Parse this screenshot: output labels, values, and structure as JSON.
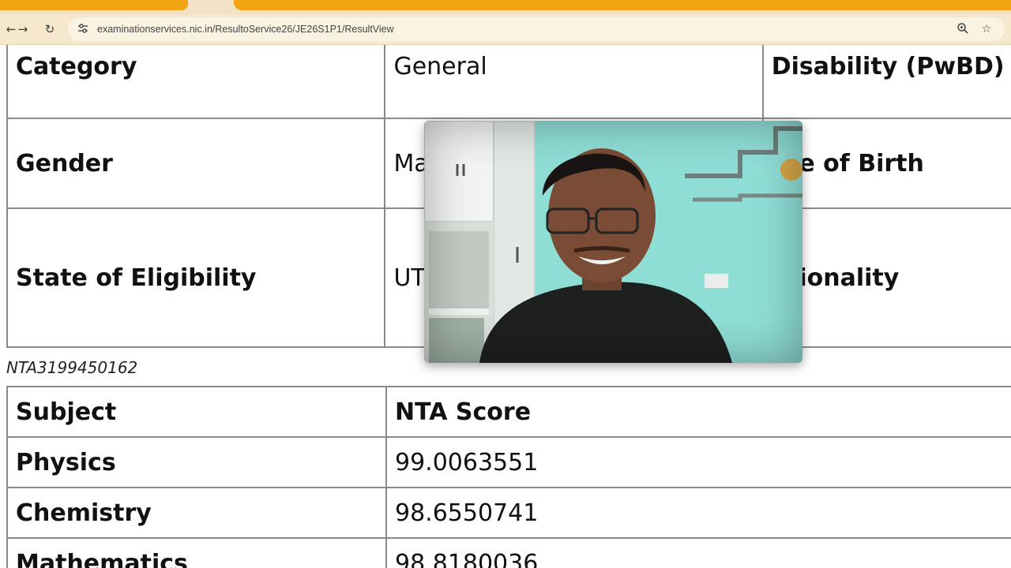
{
  "browser": {
    "url": "examinationservices.nic.in/ResultoService26/JE26S1P1/ResultView",
    "icons": {
      "back": "arrow-left-icon",
      "forward": "arrow-right-icon",
      "reload": "reload-icon",
      "site_info": "tune-icon",
      "zoom": "zoom-icon",
      "bookmark": "star-icon"
    }
  },
  "candidate_info": {
    "rows": [
      {
        "label": "Category",
        "value": "General",
        "label2": "Disability (PwBD)"
      },
      {
        "label": "Gender",
        "value": "Ma",
        "label2": "ate of Birth"
      },
      {
        "label": "State of Eligibility",
        "value": "UT",
        "label2": "ationality"
      }
    ]
  },
  "application_number": "NTA3199450162",
  "scores": {
    "header": {
      "subject": "Subject",
      "score": "NTA Score"
    },
    "rows": [
      {
        "subject": "Physics",
        "score": "99.0063551"
      },
      {
        "subject": "Chemistry",
        "score": "98.6550741"
      },
      {
        "subject": "Mathematics",
        "score": "98.8180036"
      }
    ]
  },
  "colors": {
    "browser_accent": "#f0a411",
    "toolbar_bg": "#f6e8cd",
    "table_border": "#8a8a8a",
    "webcam_wall": "#8fded6"
  }
}
